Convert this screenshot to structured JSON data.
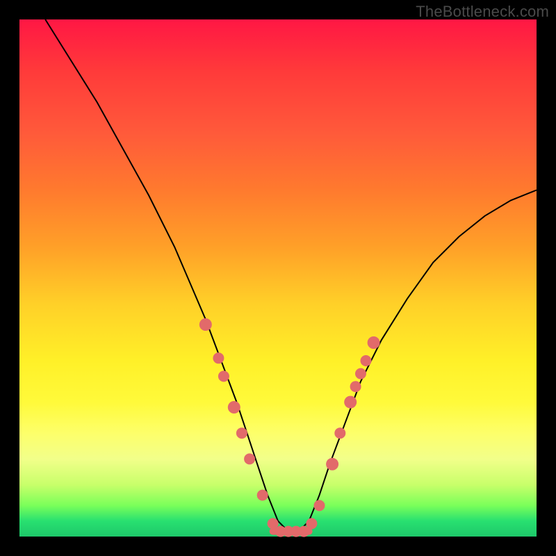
{
  "watermark": "TheBottleneck.com",
  "chart_data": {
    "type": "line",
    "title": "",
    "xlabel": "",
    "ylabel": "",
    "xlim": [
      0,
      100
    ],
    "ylim": [
      0,
      100
    ],
    "series": [
      {
        "name": "bottleneck-curve",
        "x": [
          5,
          10,
          15,
          20,
          25,
          30,
          33,
          36,
          39,
          42,
          44,
          46,
          48,
          50,
          52,
          54,
          56,
          58,
          60,
          63,
          66,
          70,
          75,
          80,
          85,
          90,
          95,
          100
        ],
        "values": [
          100,
          92,
          84,
          75,
          66,
          56,
          49,
          42,
          34,
          26,
          20,
          14,
          8,
          3,
          1,
          1,
          3,
          8,
          14,
          22,
          30,
          38,
          46,
          53,
          58,
          62,
          65,
          67
        ]
      }
    ],
    "dots": {
      "name": "highlight-dots",
      "color": "#e26a6a",
      "points": [
        {
          "x": 36.0,
          "y": 41.0,
          "r": 9
        },
        {
          "x": 38.5,
          "y": 34.5,
          "r": 8
        },
        {
          "x": 39.5,
          "y": 31.0,
          "r": 8
        },
        {
          "x": 41.5,
          "y": 25.0,
          "r": 9
        },
        {
          "x": 43.0,
          "y": 20.0,
          "r": 8
        },
        {
          "x": 44.5,
          "y": 15.0,
          "r": 8
        },
        {
          "x": 47.0,
          "y": 8.0,
          "r": 8
        },
        {
          "x": 49.0,
          "y": 2.5,
          "r": 8
        },
        {
          "x": 50.5,
          "y": 1.0,
          "r": 8
        },
        {
          "x": 52.0,
          "y": 1.0,
          "r": 8
        },
        {
          "x": 53.5,
          "y": 1.0,
          "r": 8
        },
        {
          "x": 55.0,
          "y": 1.0,
          "r": 8
        },
        {
          "x": 56.5,
          "y": 2.5,
          "r": 8
        },
        {
          "x": 58.0,
          "y": 6.0,
          "r": 8
        },
        {
          "x": 60.5,
          "y": 14.0,
          "r": 9
        },
        {
          "x": 62.0,
          "y": 20.0,
          "r": 8
        },
        {
          "x": 64.0,
          "y": 26.0,
          "r": 9
        },
        {
          "x": 65.0,
          "y": 29.0,
          "r": 8
        },
        {
          "x": 66.0,
          "y": 31.5,
          "r": 8
        },
        {
          "x": 67.0,
          "y": 34.0,
          "r": 8
        },
        {
          "x": 68.5,
          "y": 37.5,
          "r": 9
        }
      ]
    },
    "flat_bottom": {
      "x0": 49,
      "x1": 56,
      "y": 1.0,
      "color": "#e26a6a"
    }
  }
}
